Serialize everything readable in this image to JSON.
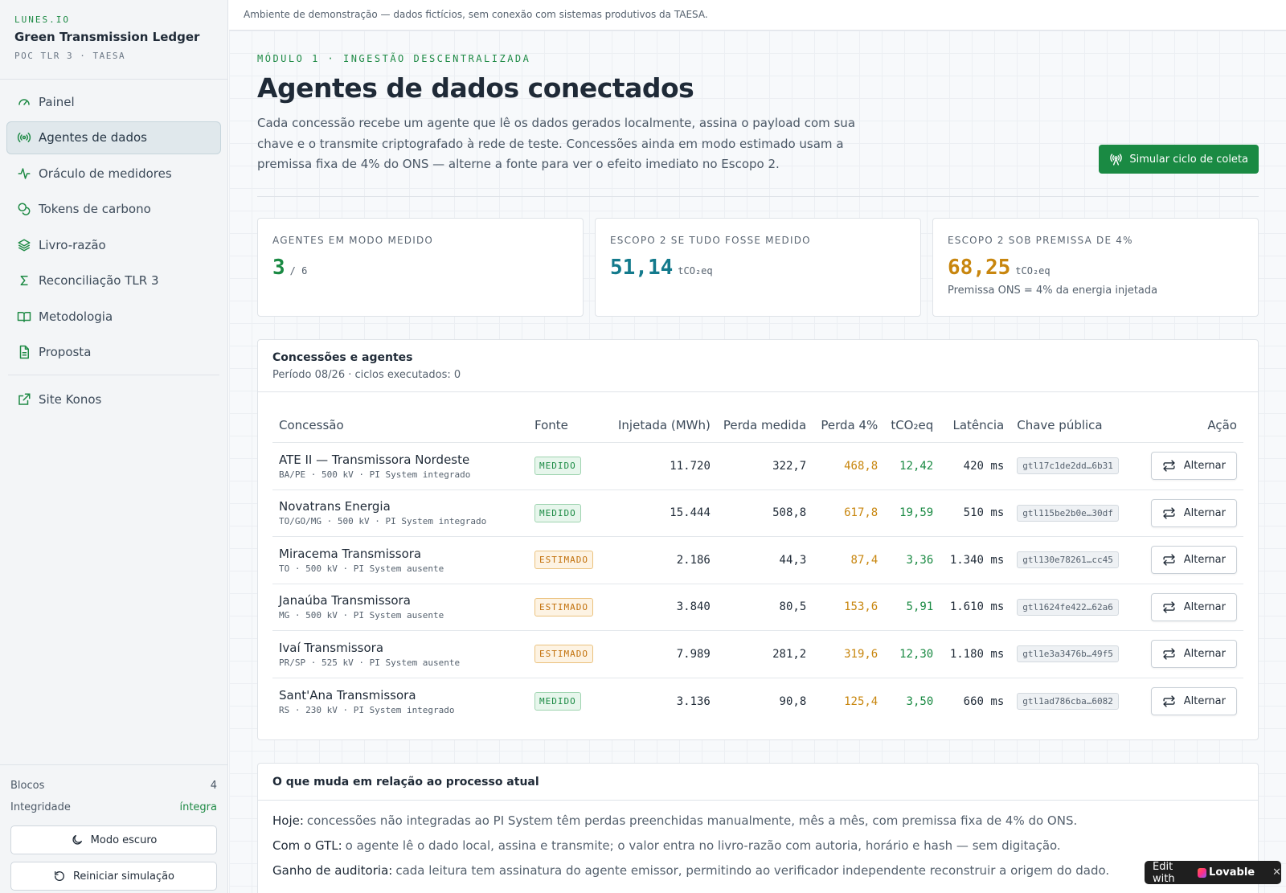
{
  "brand": {
    "top": "LUNES.IO",
    "name": "Green Transmission Ledger",
    "sub": "POC TLR 3 · TAESA"
  },
  "nav": {
    "items": [
      {
        "label": "Painel",
        "icon": "gauge-icon"
      },
      {
        "label": "Agentes de dados",
        "icon": "broadcast-icon"
      },
      {
        "label": "Oráculo de medidores",
        "icon": "pulse-icon"
      },
      {
        "label": "Tokens de carbono",
        "icon": "coins-icon"
      },
      {
        "label": "Livro-razão",
        "icon": "layers-icon"
      },
      {
        "label": "Reconciliação TLR 3",
        "icon": "sigma-icon"
      },
      {
        "label": "Metodologia",
        "icon": "book-icon"
      },
      {
        "label": "Proposta",
        "icon": "document-icon"
      }
    ],
    "external": {
      "label": "Site Konos",
      "icon": "external-link-icon"
    }
  },
  "sidebar_footer": {
    "blocks_label": "Blocos",
    "blocks_value": "4",
    "integrity_label": "Integridade",
    "integrity_value": "íntegra",
    "dark_mode_label": "Modo escuro",
    "reset_label": "Reiniciar simulação"
  },
  "topbar": {
    "notice": "Ambiente de demonstração — dados fictícios, sem conexão com sistemas produtivos da TAESA."
  },
  "header": {
    "eyebrow": "MÓDULO 1 · INGESTÃO DESCENTRALIZADA",
    "title": "Agentes de dados conectados",
    "lede": "Cada concessão recebe um agente que lê os dados gerados localmente, assina o payload com sua chave e o transmite criptografado à rede de teste. Concessões ainda em modo estimado usam a premissa fixa de 4% do ONS — alterne a fonte para ver o efeito imediato no Escopo 2.",
    "action_label": "Simular ciclo de coleta"
  },
  "cards": [
    {
      "label": "AGENTES EM MODO MEDIDO",
      "value": "3",
      "unit": "/ 6",
      "note": "",
      "color": "#1a8a43"
    },
    {
      "label": "ESCOPO 2 SE TUDO FOSSE MEDIDO",
      "value": "51,14",
      "unit": "tCO₂eq",
      "note": "",
      "color": "#137a8c"
    },
    {
      "label": "ESCOPO 2 SOB PREMISSA DE 4%",
      "value": "68,25",
      "unit": "tCO₂eq",
      "note": "Premissa ONS = 4% da energia injetada",
      "color": "#c8860e"
    }
  ],
  "table": {
    "title": "Concessões e agentes",
    "subtitle": "Período 08/26 · ciclos executados: 0",
    "columns": [
      "Concessão",
      "Fonte",
      "Injetada (MWh)",
      "Perda medida",
      "Perda 4%",
      "tCO₂eq",
      "Latência",
      "Chave pública",
      "Ação"
    ],
    "rows": [
      {
        "name": "ATE II — Transmissora Nordeste",
        "meta": "BA/PE · 500 kV · PI System integrado",
        "source": "MEDIDO",
        "injected": "11.720",
        "loss_measured": "322,7",
        "loss_4": "468,8",
        "tco2": "12,42",
        "latency": "420 ms",
        "key": "gtl17c1de2dd…6b31",
        "action": "Alternar"
      },
      {
        "name": "Novatrans Energia",
        "meta": "TO/GO/MG · 500 kV · PI System integrado",
        "source": "MEDIDO",
        "injected": "15.444",
        "loss_measured": "508,8",
        "loss_4": "617,8",
        "tco2": "19,59",
        "latency": "510 ms",
        "key": "gtl115be2b0e…30df",
        "action": "Alternar"
      },
      {
        "name": "Miracema Transmissora",
        "meta": "TO · 500 kV · PI System ausente",
        "source": "ESTIMADO",
        "injected": "2.186",
        "loss_measured": "44,3",
        "loss_4": "87,4",
        "tco2": "3,36",
        "latency": "1.340 ms",
        "key": "gtl130e78261…cc45",
        "action": "Alternar"
      },
      {
        "name": "Janaúba Transmissora",
        "meta": "MG · 500 kV · PI System ausente",
        "source": "ESTIMADO",
        "injected": "3.840",
        "loss_measured": "80,5",
        "loss_4": "153,6",
        "tco2": "5,91",
        "latency": "1.610 ms",
        "key": "gtl1624fe422…62a6",
        "action": "Alternar"
      },
      {
        "name": "Ivaí Transmissora",
        "meta": "PR/SP · 525 kV · PI System ausente",
        "source": "ESTIMADO",
        "injected": "7.989",
        "loss_measured": "281,2",
        "loss_4": "319,6",
        "tco2": "12,30",
        "latency": "1.180 ms",
        "key": "gtl1e3a3476b…49f5",
        "action": "Alternar"
      },
      {
        "name": "Sant'Ana Transmissora",
        "meta": "RS · 230 kV · PI System integrado",
        "source": "MEDIDO",
        "injected": "3.136",
        "loss_measured": "90,8",
        "loss_4": "125,4",
        "tco2": "3,50",
        "latency": "660 ms",
        "key": "gtl1ad786cba…6082",
        "action": "Alternar"
      }
    ]
  },
  "changes": {
    "title": "O que muda em relação ao processo atual",
    "items": [
      {
        "label": "Hoje:",
        "text": "concessões não integradas ao PI System têm perdas preenchidas manualmente, mês a mês, com premissa fixa de 4% do ONS."
      },
      {
        "label": "Com o GTL:",
        "text": "o agente lê o dado local, assina e transmite; o valor entra no livro-razão com autoria, horário e hash — sem digitação."
      },
      {
        "label": "Ganho de auditoria:",
        "text": "cada leitura tem assinatura do agente emissor, permitindo ao verificador independente reconstruir a origem do dado."
      }
    ]
  },
  "badge": {
    "prefix": "Edit with",
    "brand": "Lovable",
    "close": "✕"
  }
}
